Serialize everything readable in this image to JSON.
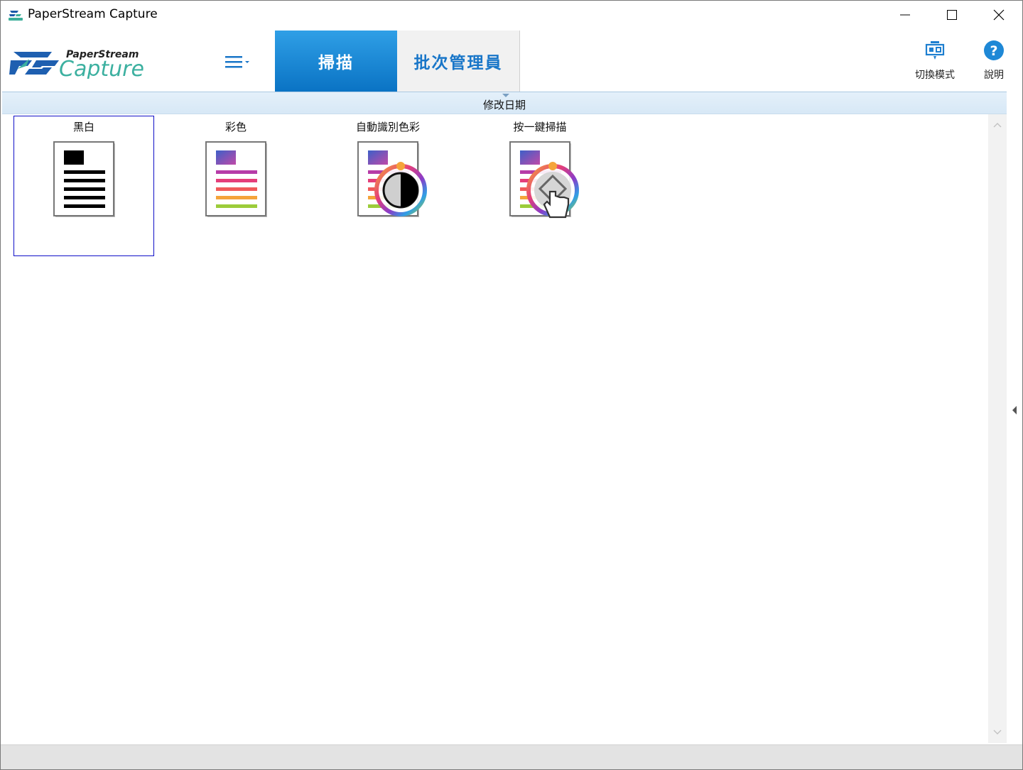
{
  "window": {
    "title": "PaperStream Capture"
  },
  "header": {
    "logo_text_top": "PaperStream",
    "logo_text_bottom": "Capture",
    "tabs": [
      {
        "label": "掃描",
        "active": true
      },
      {
        "label": "批次管理員",
        "active": false
      }
    ],
    "tools": {
      "switch_mode": "切換模式",
      "help": "說明"
    },
    "accent_color": "#0a73c4"
  },
  "sortbar": {
    "label": "修改日期"
  },
  "profiles": [
    {
      "label": "黑白",
      "icon": "bw-document-icon",
      "selected": true
    },
    {
      "label": "彩色",
      "icon": "color-document-icon",
      "selected": false
    },
    {
      "label": "自動識別色彩",
      "icon": "auto-color-document-icon",
      "selected": false
    },
    {
      "label": "按一鍵掃描",
      "icon": "one-touch-scan-icon",
      "selected": false
    }
  ]
}
